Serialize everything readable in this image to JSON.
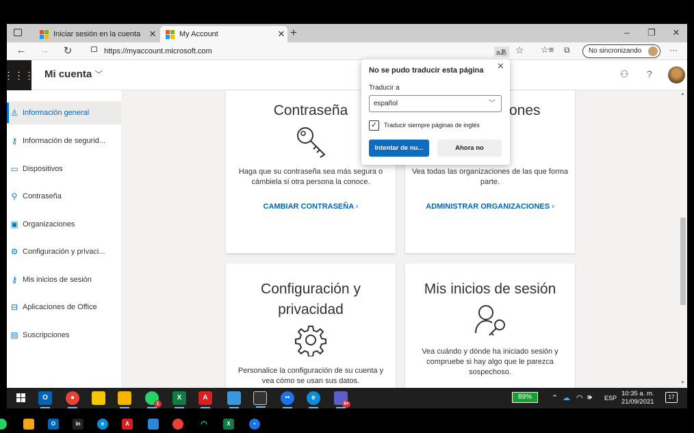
{
  "browser": {
    "tabs": [
      {
        "label": "Iniciar sesión en la cuenta"
      },
      {
        "label": "My Account"
      }
    ],
    "new_tab": "+",
    "url": "https://myaccount.microsoft.com",
    "sync_label": "No sincronizando",
    "read_aloud": "aあ",
    "more": "···"
  },
  "header": {
    "app_title": "Mi cuenta",
    "help": "?"
  },
  "sidebar": {
    "items": [
      {
        "label": "Información general",
        "icon": "person-icon",
        "active": true
      },
      {
        "label": "Información de segurid...",
        "icon": "security-info-icon"
      },
      {
        "label": "Dispositivos",
        "icon": "laptop-icon"
      },
      {
        "label": "Contraseña",
        "icon": "key-icon"
      },
      {
        "label": "Organizaciones",
        "icon": "briefcase-icon"
      },
      {
        "label": "Configuración y privaci...",
        "icon": "gear-icon"
      },
      {
        "label": "Mis inicios de sesión",
        "icon": "sign-in-icon"
      },
      {
        "label": "Aplicaciones de Office",
        "icon": "apps-icon"
      },
      {
        "label": "Suscripciones",
        "icon": "card-icon"
      }
    ]
  },
  "cards": {
    "password": {
      "title": "Contraseña",
      "desc": "Haga que su contraseña sea más segura o cámbiela si otra persona la conoce.",
      "link": "CAMBIAR CONTRASEÑA"
    },
    "orgs": {
      "title_fragment": "ones",
      "desc": "Vea todas las organizaciones de las que forma parte.",
      "link": "ADMINISTRAR ORGANIZACIONES"
    },
    "privacy": {
      "title_line1": "Configuración y",
      "title_line2": "privacidad",
      "desc": "Personalice la configuración de su cuenta y vea cómo se usan sus datos."
    },
    "signins": {
      "title": "Mis inicios de sesión",
      "desc": "Vea cuándo y dónde ha iniciado sesión y compruebe si hay algo que le parezca sospechoso."
    }
  },
  "translate_popup": {
    "title": "No se pudo traducir esta página",
    "translate_to_label": "Traducir a",
    "language": "español",
    "always_translate": "Traducir siempre páginas de inglés",
    "always_checked": true,
    "retry_button": "Intentar de nu...",
    "not_now_button": "Ahora no"
  },
  "taskbar": {
    "battery": "89%",
    "language": "ESP",
    "time": "10:35 a. m.",
    "date": "21/09/2021",
    "notification_count": "17",
    "whatsapp_badge": "1",
    "teams_badge": "9+"
  },
  "colors": {
    "accent": "#0078d4",
    "link": "#0067b8",
    "primary_button": "#0f6cbd",
    "battery": "#16a02c"
  }
}
